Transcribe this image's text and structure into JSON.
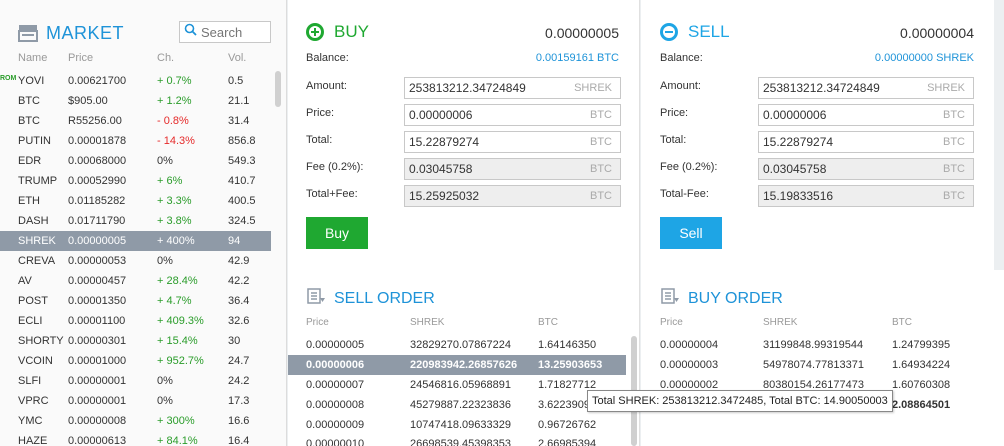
{
  "market": {
    "title": "MARKET",
    "search_placeholder": "Search",
    "columns": [
      "Name",
      "Price",
      "Ch.",
      "Vol."
    ],
    "badge": "ROM",
    "rows": [
      {
        "name": "YOVI",
        "price": "0.00621700",
        "ch": "+ 0.7%",
        "vol": "0.5",
        "dir": "up"
      },
      {
        "name": "BTC",
        "price": "$905.00",
        "ch": "+ 1.2%",
        "vol": "21.1",
        "dir": "up"
      },
      {
        "name": "BTC",
        "price": "R55256.00",
        "ch": "- 0.8%",
        "vol": "31.4",
        "dir": "down"
      },
      {
        "name": "PUTIN",
        "price": "0.00001878",
        "ch": "- 14.3%",
        "vol": "856.8",
        "dir": "down"
      },
      {
        "name": "EDR",
        "price": "0.00068000",
        "ch": "0%",
        "vol": "549.3",
        "dir": "flat"
      },
      {
        "name": "TRUMP",
        "price": "0.00052990",
        "ch": "+ 6%",
        "vol": "410.7",
        "dir": "up"
      },
      {
        "name": "ETH",
        "price": "0.01185282",
        "ch": "+ 3.3%",
        "vol": "400.5",
        "dir": "up"
      },
      {
        "name": "DASH",
        "price": "0.01711790",
        "ch": "+ 3.8%",
        "vol": "324.5",
        "dir": "up"
      },
      {
        "name": "SHREK",
        "price": "0.00000005",
        "ch": "+ 400%",
        "vol": "94",
        "dir": "up"
      },
      {
        "name": "CREVA",
        "price": "0.00000053",
        "ch": "0%",
        "vol": "42.9",
        "dir": "flat"
      },
      {
        "name": "AV",
        "price": "0.00000457",
        "ch": "+ 28.4%",
        "vol": "42.2",
        "dir": "up"
      },
      {
        "name": "POST",
        "price": "0.00001350",
        "ch": "+ 4.7%",
        "vol": "36.4",
        "dir": "up"
      },
      {
        "name": "ECLI",
        "price": "0.00001100",
        "ch": "+ 409.3%",
        "vol": "32.6",
        "dir": "up"
      },
      {
        "name": "SHORTY",
        "price": "0.00000301",
        "ch": "+ 15.4%",
        "vol": "30",
        "dir": "up"
      },
      {
        "name": "VCOIN",
        "price": "0.00001000",
        "ch": "+ 952.7%",
        "vol": "24.7",
        "dir": "up"
      },
      {
        "name": "SLFI",
        "price": "0.00000001",
        "ch": "0%",
        "vol": "24.2",
        "dir": "flat"
      },
      {
        "name": "VPRC",
        "price": "0.00000001",
        "ch": "0%",
        "vol": "17.3",
        "dir": "flat"
      },
      {
        "name": "YMC",
        "price": "0.00000008",
        "ch": "+ 300%",
        "vol": "16.6",
        "dir": "up"
      },
      {
        "name": "HAZE",
        "price": "0.00000613",
        "ch": "+ 84.1%",
        "vol": "16.4",
        "dir": "up"
      }
    ]
  },
  "buy": {
    "title": "BUY",
    "price_display": "0.00000005",
    "balance_label": "Balance:",
    "balance_value": "0.00159161 BTC",
    "amount_label": "Amount:",
    "amount_value": "253813212.34724849",
    "amount_unit": "SHREK",
    "price_label": "Price:",
    "price_value": "0.00000006",
    "price_unit": "BTC",
    "total_label": "Total:",
    "total_value": "15.22879274",
    "total_unit": "BTC",
    "fee_label": "Fee (0.2%):",
    "fee_value": "0.03045758",
    "fee_unit": "BTC",
    "totalfee_label": "Total+Fee:",
    "totalfee_value": "15.25925032",
    "totalfee_unit": "BTC",
    "button": "Buy"
  },
  "sell": {
    "title": "SELL",
    "price_display": "0.00000004",
    "balance_label": "Balance:",
    "balance_value": "0.00000000 SHREK",
    "amount_label": "Amount:",
    "amount_value": "253813212.34724849",
    "amount_unit": "SHREK",
    "price_label": "Price:",
    "price_value": "0.00000006",
    "price_unit": "BTC",
    "total_label": "Total:",
    "total_value": "15.22879274",
    "total_unit": "BTC",
    "fee_label": "Fee (0.2%):",
    "fee_value": "0.03045758",
    "fee_unit": "BTC",
    "totalfee_label": "Total-Fee:",
    "totalfee_value": "15.19833516",
    "totalfee_unit": "BTC",
    "button": "Sell"
  },
  "sell_order": {
    "title": "SELL ORDER",
    "columns": [
      "Price",
      "SHREK",
      "BTC"
    ],
    "rows": [
      {
        "price": "0.00000005",
        "amount": "32829270.07867224",
        "btc": "1.64146350"
      },
      {
        "price": "0.00000006",
        "amount": "220983942.26857626",
        "btc": "13.25903653"
      },
      {
        "price": "0.00000007",
        "amount": "24546816.05968891",
        "btc": "1.71827712"
      },
      {
        "price": "0.00000008",
        "amount": "45279887.22323836",
        "btc": "3.6223909"
      },
      {
        "price": "0.00000009",
        "amount": "10747418.09633329",
        "btc": "0.96726762"
      },
      {
        "price": "0.00000010",
        "amount": "26698539.45398353",
        "btc": "2.66985394"
      }
    ]
  },
  "buy_order": {
    "title": "BUY ORDER",
    "columns": [
      "Price",
      "SHREK",
      "BTC"
    ],
    "rows": [
      {
        "price": "0.00000004",
        "amount": "31199848.99319544",
        "btc": "1.24799395"
      },
      {
        "price": "0.00000003",
        "amount": "54978074.77813371",
        "btc": "1.64934224"
      },
      {
        "price": "0.00000002",
        "amount": "80380154.26177473",
        "btc": "1.60760308"
      },
      {
        "price": "",
        "amount": "",
        "btc": "2.08864501"
      }
    ]
  },
  "tooltip": "Total SHREK: 253813212.3472485, Total BTC: 14.90050003",
  "colors": {
    "accent": "#1e93d8",
    "buy_green": "#1fa831",
    "sell_blue": "#1ea5e5",
    "up": "#2a9c2a",
    "down": "#e52a2a",
    "highlight": "#8f9aa7"
  }
}
